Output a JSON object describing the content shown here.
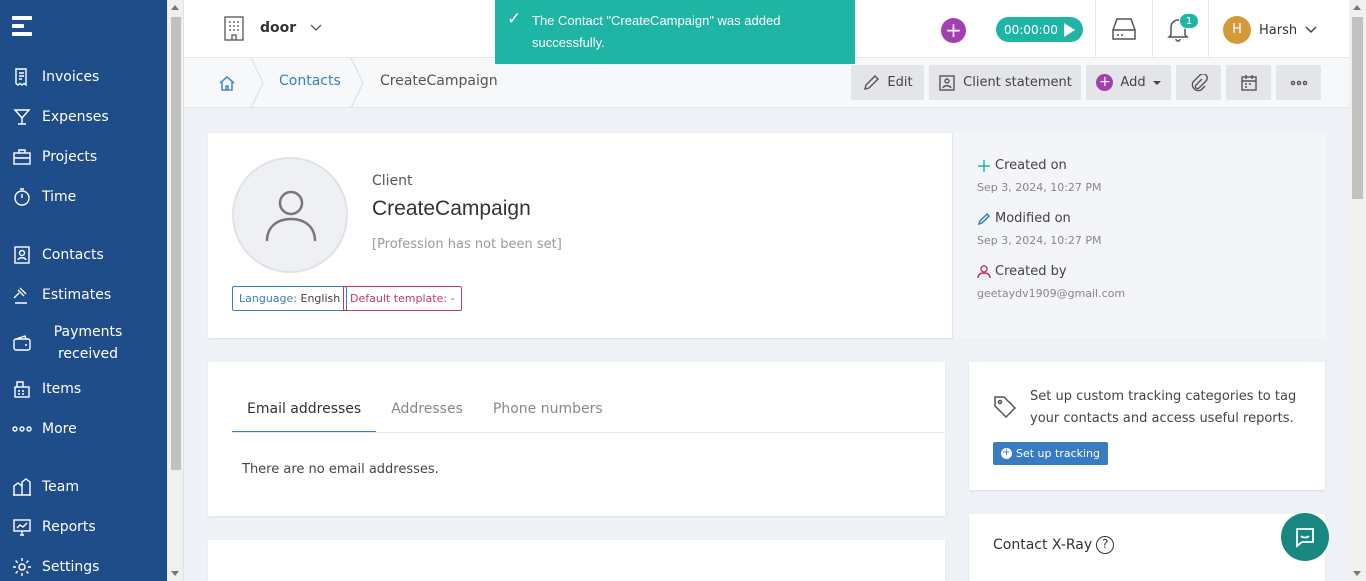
{
  "sidebar": {
    "items": [
      {
        "label": "Invoices",
        "icon": "invoice-icon"
      },
      {
        "label": "Expenses",
        "icon": "glass-icon"
      },
      {
        "label": "Projects",
        "icon": "briefcase-icon"
      },
      {
        "label": "Time",
        "icon": "stopwatch-icon"
      },
      {
        "label": "Contacts",
        "icon": "contacts-icon"
      },
      {
        "label": "Estimates",
        "icon": "gavel-icon"
      },
      {
        "label": "Payments received",
        "icon": "wallet-icon"
      },
      {
        "label": "Items",
        "icon": "cash-register-icon"
      },
      {
        "label": "More",
        "icon": "more-dots-icon"
      },
      {
        "label": "Team",
        "icon": "team-icon"
      },
      {
        "label": "Reports",
        "icon": "reports-icon"
      },
      {
        "label": "Settings",
        "icon": "gear-icon"
      }
    ]
  },
  "topbar": {
    "company": "door",
    "timer": "00:00:00",
    "notifications_count": "1",
    "user_initial": "H",
    "user_name": "Harsh"
  },
  "toast": {
    "message": "The Contact \"CreateCampaign\" was added successfully."
  },
  "breadcrumb": {
    "link": "Contacts",
    "current": "CreateCampaign"
  },
  "actions": {
    "edit": "Edit",
    "client_statement": "Client statement",
    "add": "Add"
  },
  "contact": {
    "type": "Client",
    "name": "CreateCampaign",
    "profession": "[Profession has not been set]",
    "language_label": "Language:",
    "language_value": "English",
    "template_label": "Default template:",
    "template_value": "-"
  },
  "meta": {
    "created_label": "Created on",
    "created_value": "Sep 3, 2024, 10:27 PM",
    "modified_label": "Modified on",
    "modified_value": "Sep 3, 2024, 10:27 PM",
    "created_by_label": "Created by",
    "created_by_value": "geetaydv1909@gmail.com"
  },
  "details": {
    "tabs": [
      "Email addresses",
      "Addresses",
      "Phone numbers"
    ],
    "empty": "There are no email addresses."
  },
  "tracking": {
    "text": "Set up custom tracking categories to tag your contacts and access useful reports.",
    "button": "Set up tracking"
  },
  "xray": {
    "title": "Contact X-Ray"
  },
  "colors": {
    "sidebar": "#1f4d8a",
    "accent_teal": "#1fb5a5",
    "accent_purple": "#a23fb1",
    "link_blue": "#3a7cc2"
  }
}
